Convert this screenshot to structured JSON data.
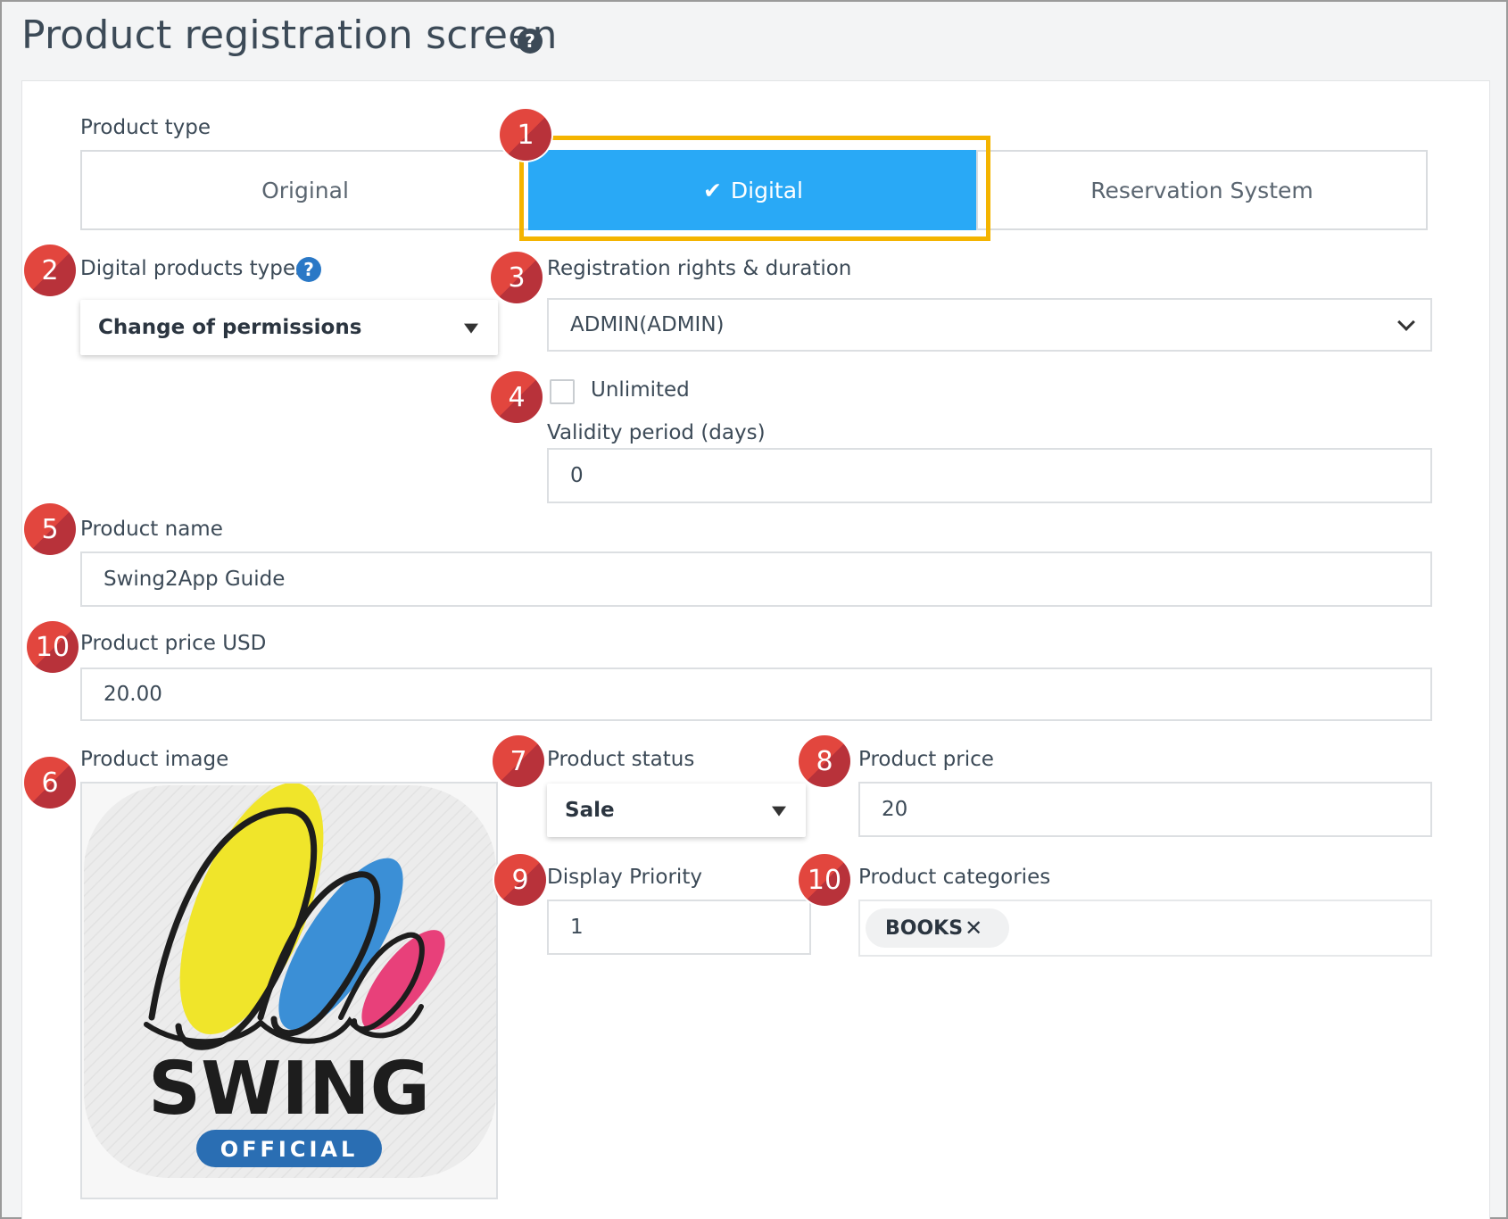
{
  "page": {
    "title": "Product registration screen",
    "help_icon": "question-circle-icon"
  },
  "product_type": {
    "label": "Product type",
    "options": [
      "Original",
      "Digital",
      "Reservation System"
    ],
    "selected": "Digital",
    "check_glyph": "✔"
  },
  "badges": [
    "1",
    "2",
    "3",
    "4",
    "5",
    "10",
    "6",
    "7",
    "8",
    "9",
    "10"
  ],
  "digital_types": {
    "label": "Digital products types",
    "value": "Change of permissions",
    "help_icon": "question-circle-icon"
  },
  "registration": {
    "label": "Registration rights & duration",
    "value": "ADMIN(ADMIN)"
  },
  "unlimited": {
    "label": "Unlimited",
    "checked": false
  },
  "validity": {
    "label": "Validity period (days)",
    "value": "0"
  },
  "product_name": {
    "label": "Product name",
    "value": "Swing2App Guide"
  },
  "price_usd": {
    "label": "Product price USD",
    "value": "20.00"
  },
  "product_image": {
    "label": "Product image",
    "logo_text": "SWING",
    "logo_sub": "OFFICIAL"
  },
  "product_status": {
    "label": "Product status",
    "value": "Sale"
  },
  "product_price": {
    "label": "Product price",
    "value": "20"
  },
  "display_priority": {
    "label": "Display Priority",
    "value": "1"
  },
  "categories": {
    "label": "Product categories",
    "tags": [
      "BOOKS"
    ],
    "remove_glyph": "✕"
  },
  "colors": {
    "accent": "#29a9f6",
    "highlight": "#f4b400",
    "badge": "#e2463e",
    "logo_yellow": "#f0e52a",
    "logo_blue": "#3b8fd6",
    "logo_pink": "#e8407a",
    "logo_badge": "#2a6eb3"
  }
}
